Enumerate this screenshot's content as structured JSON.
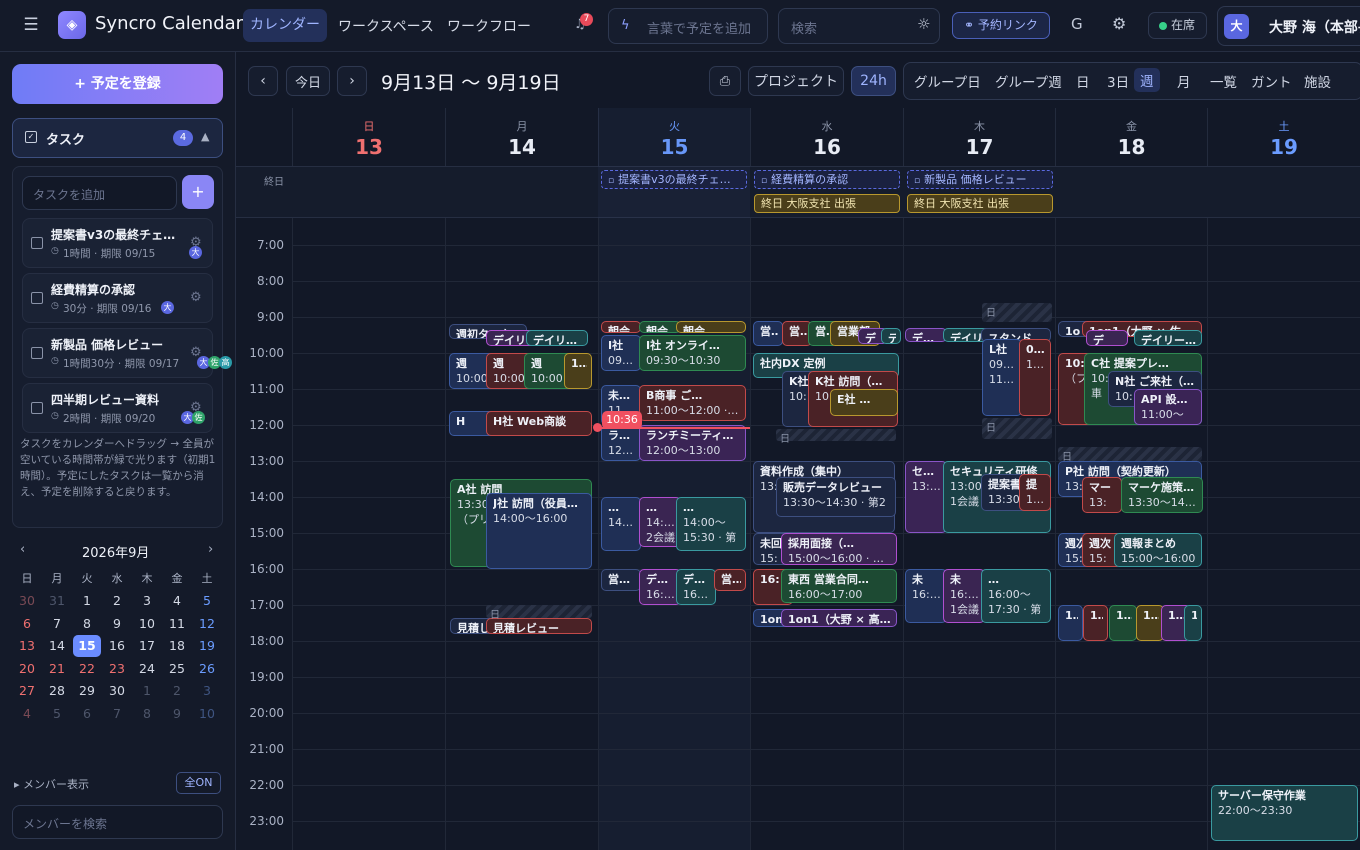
{
  "app": {
    "title": "Syncro Calendar",
    "notif_count": "7"
  },
  "nav": {
    "tabs": [
      "カレンダー",
      "ワークスペース",
      "ワークフロー"
    ]
  },
  "header": {
    "quick_add_placeholder": "言葉で予定を追加",
    "search_placeholder": "検索",
    "booking_link": "予約リンク",
    "g": "G",
    "status": "在席",
    "user_initial": "大",
    "user_name": "大野 海（本部長"
  },
  "sidebar": {
    "register_button": "+ 予定を登録",
    "tasks_title": "タスク",
    "tasks_count": "4",
    "task_input_placeholder": "タスクを追加",
    "add": "+",
    "tasks": [
      {
        "title": "提案書v3の最終チェ…",
        "meta": "1時間 · 期限 09/15",
        "avatars": [
          "大"
        ]
      },
      {
        "title": "経費精算の承認",
        "meta": "30分 · 期限 09/16",
        "avatars": [
          "大"
        ]
      },
      {
        "title": "新製品 価格レビュー",
        "meta": "1時間30分 · 期限 09/17",
        "avatars": [
          "大",
          "佐",
          "高"
        ]
      },
      {
        "title": "四半期レビュー資料",
        "meta": "2時間 · 期限 09/20",
        "avatars": [
          "大",
          "佐"
        ]
      }
    ],
    "hint": "タスクをカレンダーへドラッグ → 全員が空いている時間帯が緑で光ります（初期1時間）。予定にしたタスクは一覧から消え、予定を削除すると戻ります。",
    "mini_cal": {
      "title": "2026年9月",
      "prev": "‹",
      "next": "›",
      "dow": [
        "日",
        "月",
        "火",
        "水",
        "木",
        "金",
        "土"
      ],
      "weeks": [
        [
          "30",
          "31",
          "1",
          "2",
          "3",
          "4",
          "5"
        ],
        [
          "6",
          "7",
          "8",
          "9",
          "10",
          "11",
          "12"
        ],
        [
          "13",
          "14",
          "15",
          "16",
          "17",
          "18",
          "19"
        ],
        [
          "20",
          "21",
          "22",
          "23",
          "24",
          "25",
          "26"
        ],
        [
          "27",
          "28",
          "29",
          "30",
          "1",
          "2",
          "3"
        ],
        [
          "4",
          "5",
          "6",
          "7",
          "8",
          "9",
          "10"
        ]
      ]
    },
    "members_label": "メンバー表示",
    "all_on": "全ON",
    "member_search_placeholder": "メンバーを検索"
  },
  "toolbar": {
    "prev": "‹",
    "today": "今日",
    "next": "›",
    "range": "9月13日 〜 9月19日",
    "project": "プロジェクト",
    "h24": "24h",
    "views": [
      "グループ日",
      "グループ週",
      "日",
      "3日",
      "週",
      "月",
      "一覧",
      "ガント",
      "施設"
    ]
  },
  "week": {
    "allday_label": "終日",
    "days": [
      {
        "dow": "日",
        "num": "13"
      },
      {
        "dow": "月",
        "num": "14"
      },
      {
        "dow": "火",
        "num": "15"
      },
      {
        "dow": "水",
        "num": "16"
      },
      {
        "dow": "木",
        "num": "17"
      },
      {
        "dow": "金",
        "num": "18"
      },
      {
        "dow": "土",
        "num": "19"
      }
    ],
    "hours": [
      "7:00",
      "8:00",
      "9:00",
      "10:00",
      "11:00",
      "12:00",
      "13:00",
      "14:00",
      "15:00",
      "16:00",
      "17:00",
      "18:00",
      "19:00",
      "20:00",
      "21:00",
      "22:00",
      "23:00"
    ],
    "now_label": "10:36",
    "allday": [
      {
        "t": "提案書v3の最終チェ…",
        "k": "task"
      },
      {
        "t": "経費精算の承認",
        "k": "task"
      },
      {
        "t": "新製品 価格レビュー",
        "k": "task"
      },
      {
        "t": "終日 大阪支社 出張",
        "k": "gold"
      },
      {
        "t": "終日 大阪支社 出張",
        "k": "gold"
      }
    ],
    "events": [
      {
        "t": "週初タスク整理"
      },
      {
        "t": "デイリ"
      },
      {
        "t": "デイリー…"
      },
      {
        "t": "週",
        "s": "10:00"
      },
      {
        "t": "週",
        "s": "10:00"
      },
      {
        "t": "週",
        "s": "10:00"
      },
      {
        "t": "10:0"
      },
      {
        "t": "H"
      },
      {
        "t": "H社 Web商談"
      },
      {
        "t": "A社 訪問",
        "s": "13:30",
        "s2": "（プリ"
      },
      {
        "t": "J社 訪問（役員…",
        "s": "14:00〜16:00"
      },
      {
        "t": "見積し"
      },
      {
        "t": "見積レビュー"
      },
      {
        "t": "朝会"
      },
      {
        "t": "朝会"
      },
      {
        "t": "朝会"
      },
      {
        "t": "I社",
        "s": "09:30"
      },
      {
        "t": "I社 オンライ…",
        "s": "09:30〜10:30"
      },
      {
        "t": "未回答",
        "s": "11:00"
      },
      {
        "t": "B商事 ご…",
        "s": "11:00〜12:00 · 応"
      },
      {
        "t": "ランチ",
        "s": "12:00"
      },
      {
        "t": "ランチミーティ…",
        "s": "12:00〜13:00"
      },
      {
        "t": "…",
        "s": "14:00"
      },
      {
        "t": "…",
        "s": "14:00",
        "s2": "2会議"
      },
      {
        "t": "…",
        "s": "14:00〜",
        "s2": "15:30 · 第"
      },
      {
        "t": "営業数"
      },
      {
        "t": "デザイ",
        "s": "16:00"
      },
      {
        "t": "デザイ",
        "s": "16:00"
      },
      {
        "t": "営…"
      },
      {
        "t": "営業"
      },
      {
        "t": "営業"
      },
      {
        "t": "営業"
      },
      {
        "t": "営業部"
      },
      {
        "t": "デ"
      },
      {
        "t": "デ"
      },
      {
        "t": "社内DX 定例"
      },
      {
        "t": "K社",
        "s": "10:"
      },
      {
        "t": "K社 訪問（定…",
        "s": "10:"
      },
      {
        "t": "E社 …"
      },
      {
        "t": "資料作成（集中）",
        "s": "13:"
      },
      {
        "t": "販売データレビュー",
        "s": "13:30〜14:30 · 第2"
      },
      {
        "t": "未回",
        "s": "15:"
      },
      {
        "t": "採用面接（…",
        "s": "15:00〜16:00 · 応接"
      },
      {
        "t": "16:"
      },
      {
        "t": "東西 営業合同…",
        "s": "16:00〜17:00"
      },
      {
        "t": "1on"
      },
      {
        "t": "1on1（大野 × 高…"
      },
      {
        "t": "デイリ"
      },
      {
        "t": "デイリ"
      },
      {
        "t": "スタンドアップ"
      },
      {
        "t": "L社",
        "s": "09:30",
        "s2": "11:30"
      },
      {
        "t": "09:3",
        "s": "11:3"
      },
      {
        "t": "セキュ",
        "s": "13:00"
      },
      {
        "t": "セキュリティ研修",
        "s": "13:00",
        "s2": "1会議"
      },
      {
        "t": "提案書",
        "s": "13:30"
      },
      {
        "t": "提",
        "s": "13:3"
      },
      {
        "t": "未",
        "s": "16:00"
      },
      {
        "t": "未",
        "s": "16:00",
        "s2": "1会議"
      },
      {
        "t": "…",
        "s": "16:00〜",
        "s2": "17:30 · 第"
      },
      {
        "t": "1o"
      },
      {
        "t": "1on1（大野 × 佐…"
      },
      {
        "t": "デ"
      },
      {
        "t": "デイリー…"
      },
      {
        "t": "10:",
        "s": "（フ"
      },
      {
        "t": "C社 提案プレ…",
        "s": "10:",
        "s2": "車"
      },
      {
        "t": "N社 ご来社（…",
        "s": "10:"
      },
      {
        "t": "API 設…",
        "s": "11:00〜"
      },
      {
        "t": "P社 訪問（契約更新）",
        "s": "13:"
      },
      {
        "t": "マー",
        "s": "13:"
      },
      {
        "t": "マーケ施策ブ…",
        "s": "13:30〜14:30 ·"
      },
      {
        "t": "週次",
        "s": "15:"
      },
      {
        "t": "週次",
        "s": "15:"
      },
      {
        "t": "週報まとめ",
        "s": "15:00〜16:00"
      },
      {
        "t": "17:"
      },
      {
        "t": "17:"
      },
      {
        "t": "17:"
      },
      {
        "t": "17:"
      },
      {
        "t": "17:"
      },
      {
        "t": "17"
      },
      {
        "t": "サーバー保守作業",
        "s": "22:00〜23:30"
      }
    ],
    "busy": [
      "日",
      "日",
      "日",
      "日",
      "日",
      "日",
      "日",
      "日",
      "日"
    ]
  },
  "colors": {
    "accent": "#7b7ff5",
    "today": "#6b8cff",
    "sunday": "#f06b6b",
    "saturday": "#6b9cff",
    "now": "#f05060"
  }
}
